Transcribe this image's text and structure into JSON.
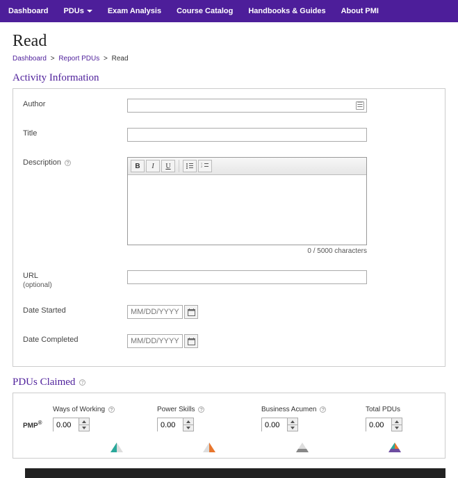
{
  "nav": {
    "items": [
      {
        "label": "Dashboard"
      },
      {
        "label": "PDUs",
        "dropdown": true
      },
      {
        "label": "Exam Analysis"
      },
      {
        "label": "Course Catalog"
      },
      {
        "label": "Handbooks & Guides"
      },
      {
        "label": "About PMI"
      }
    ]
  },
  "page_title": "Read",
  "breadcrumb": {
    "items": [
      "Dashboard",
      "Report PDUs"
    ],
    "current": "Read"
  },
  "sections": {
    "activity_info": "Activity Information",
    "pdus_claimed": "PDUs Claimed"
  },
  "form": {
    "author": {
      "label": "Author",
      "value": ""
    },
    "title": {
      "label": "Title",
      "value": ""
    },
    "description": {
      "label": "Description",
      "value": "",
      "char_count": "0 / 5000 characters"
    },
    "url": {
      "label": "URL",
      "sublabel": "(optional)",
      "value": ""
    },
    "date_started": {
      "label": "Date Started",
      "placeholder": "MM/DD/YYYY",
      "value": ""
    },
    "date_completed": {
      "label": "Date Completed",
      "placeholder": "MM/DD/YYYY",
      "value": ""
    }
  },
  "pdus": {
    "cert": "PMP",
    "cert_suffix": "®",
    "columns": [
      {
        "label": "Ways of Working",
        "help": true,
        "value": "0.00",
        "tri": "teal"
      },
      {
        "label": "Power Skills",
        "help": true,
        "value": "0.00",
        "tri": "orange"
      },
      {
        "label": "Business Acumen",
        "help": true,
        "value": "0.00",
        "tri": "grey"
      },
      {
        "label": "Total PDUs",
        "help": false,
        "value": "0.00",
        "tri": "full"
      }
    ]
  }
}
